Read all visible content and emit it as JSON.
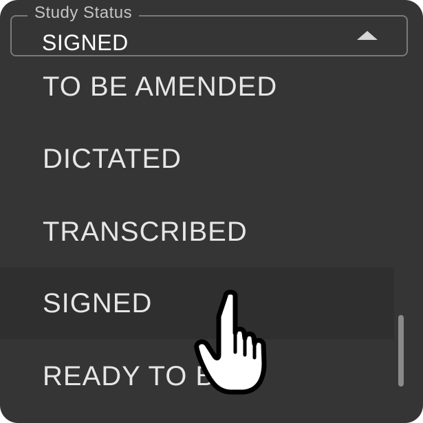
{
  "field": {
    "legend": "Study Status",
    "value": "SIGNED"
  },
  "options": [
    {
      "label": "TO BE AMENDED"
    },
    {
      "label": "DICTATED"
    },
    {
      "label": "TRANSCRIBED"
    },
    {
      "label": "SIGNED"
    },
    {
      "label": "READY TO BILL"
    }
  ],
  "icons": {
    "caret": "caret-up-icon",
    "cursor": "hand-pointer-cursor-icon"
  },
  "colors": {
    "background": "#353535",
    "selected_row": "#2f2f2f",
    "text": "#e6e6e6",
    "border": "#7a7a7a"
  }
}
